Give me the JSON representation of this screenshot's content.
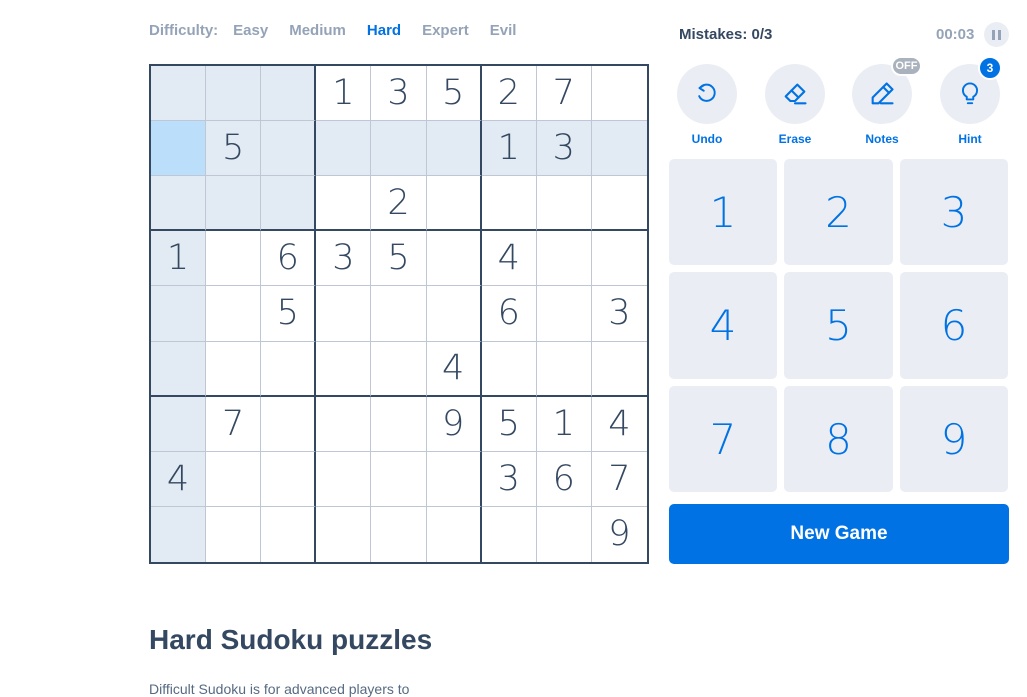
{
  "difficulty": {
    "label": "Difficulty:",
    "options": [
      "Easy",
      "Medium",
      "Hard",
      "Expert",
      "Evil"
    ],
    "selected": "Hard"
  },
  "status": {
    "mistakes": "Mistakes: 0/3",
    "timer": "00:03",
    "pause_icon": "pause-icon"
  },
  "board": {
    "rows": [
      [
        "",
        "",
        "",
        "1",
        "3",
        "5",
        "2",
        "7",
        ""
      ],
      [
        "",
        "5",
        "",
        "",
        "",
        "",
        "1",
        "3",
        ""
      ],
      [
        "",
        "",
        "",
        "",
        "2",
        "",
        "",
        "",
        ""
      ],
      [
        "1",
        "",
        "6",
        "3",
        "5",
        "",
        "4",
        "",
        ""
      ],
      [
        "",
        "",
        "5",
        "",
        "",
        "",
        "6",
        "",
        "3"
      ],
      [
        "",
        "",
        "",
        "",
        "",
        "4",
        "",
        "",
        ""
      ],
      [
        "",
        "7",
        "",
        "",
        "",
        "9",
        "5",
        "1",
        "4"
      ],
      [
        "4",
        "",
        "",
        "",
        "",
        "",
        "3",
        "6",
        "7"
      ],
      [
        "",
        "",
        "",
        "",
        "",
        "",
        "",
        "",
        "9"
      ]
    ],
    "selected_cell": {
      "row": 2,
      "col": 1
    },
    "colors": {
      "text": "#344861",
      "highlight": "#e2ebf3",
      "selected": "#bbdefb",
      "border": "#344861",
      "thin_border": "#bfc6d4"
    }
  },
  "tools": {
    "undo": {
      "label": "Undo",
      "icon": "undo-icon"
    },
    "erase": {
      "label": "Erase",
      "icon": "eraser-icon"
    },
    "notes": {
      "label": "Notes",
      "icon": "pencil-icon",
      "badge": "OFF"
    },
    "hint": {
      "label": "Hint",
      "icon": "lightbulb-icon",
      "badge": "3"
    }
  },
  "numpad": [
    "1",
    "2",
    "3",
    "4",
    "5",
    "6",
    "7",
    "8",
    "9"
  ],
  "new_game": "New Game",
  "content": {
    "heading": "Hard Sudoku puzzles",
    "description": "Difficult Sudoku is for advanced players to"
  },
  "colors": {
    "accent": "#0072e3",
    "muted": "#94a3b7",
    "button_bg": "#eaeef4"
  }
}
